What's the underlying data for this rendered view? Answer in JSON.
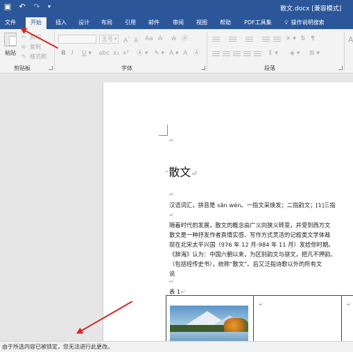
{
  "titlebar": {
    "document_title": "散文.docx [兼容模式]"
  },
  "tabs": [
    "文件",
    "开始",
    "插入",
    "设计",
    "布局",
    "引用",
    "邮件",
    "审阅",
    "视图",
    "帮助",
    "PDF工具集"
  ],
  "active_tab": "开始",
  "tell_me": "操作说明搜索",
  "ribbon": {
    "clipboard": {
      "group_label": "剪贴板",
      "paste_label": "粘贴",
      "cut_label": "剪切",
      "copy_label": "复制",
      "format_painter_label": "格式刷"
    },
    "font": {
      "group_label": "字体",
      "font_name": "",
      "font_size": "五号"
    },
    "paragraph": {
      "group_label": "段落"
    }
  },
  "document": {
    "heading": "散文",
    "lines": [
      "汉语词汇，拼音是 sǎn wén。一指文采焕发；二指韵文；[1]三指",
      "随着时代的发展，散文的概念由广义向狭义转变，并受到西方文",
      "散文是一种抒发作者真情实感、写作方式灵活的记叙类文学体裁",
      "现在北宋太平兴国（976 年 12 月-984 年 11 月）发给你时期。",
      "《辞海》认为：中国六朝以来，为区别韵文与骈文，把凡不押韵、",
      "（包括经传史书），统称“散文”。后又泛指诗歌以外的所有文",
      "说"
    ],
    "table_caption": "表  1"
  },
  "statusbar": {
    "message": "由于所选内容已被锁定，您无法进行此更改。"
  },
  "colors": {
    "title_bar": "#2b579a",
    "ribbon_bg": "#f3f3f3",
    "annotation_arrow": "#d7261f"
  }
}
